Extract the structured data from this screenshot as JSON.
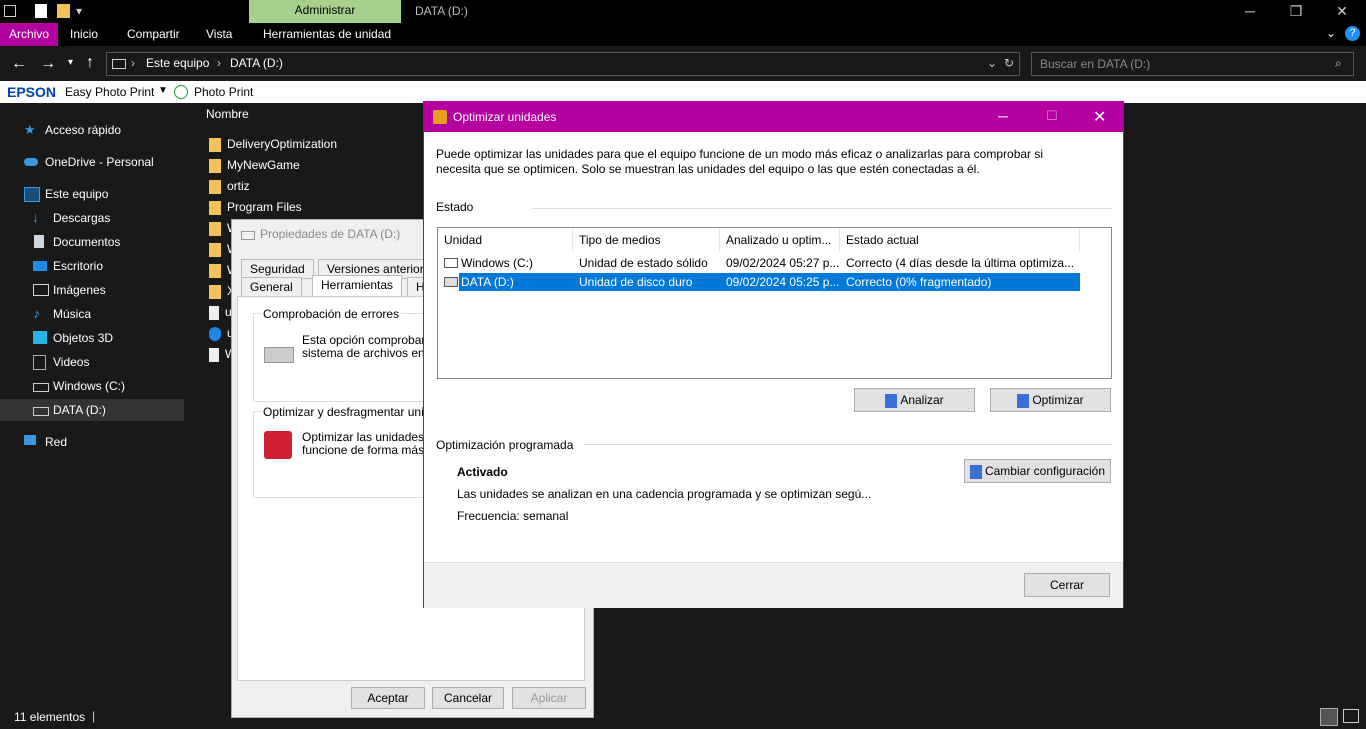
{
  "explorer": {
    "window_title": "DATA (D:)",
    "manage_tab": "Administrar",
    "ribbon_tabs": [
      "Archivo",
      "Inicio",
      "Compartir",
      "Vista",
      "Herramientas de unidad"
    ],
    "breadcrumb": [
      "Este equipo",
      "DATA (D:)"
    ],
    "search_placeholder": "Buscar en DATA (D:)",
    "epson_brand": "EPSON",
    "epson_app": "Easy Photo Print",
    "photo_print": "Photo Print",
    "sidebar": [
      {
        "label": "Acceso rápido",
        "icon": "star-icon"
      },
      {
        "label": "OneDrive - Personal",
        "icon": "cloud-icon"
      },
      {
        "label": "Este equipo",
        "icon": "computer-icon"
      },
      {
        "label": "Descargas",
        "icon": "download-icon"
      },
      {
        "label": "Documentos",
        "icon": "document-icon"
      },
      {
        "label": "Escritorio",
        "icon": "desktop-icon"
      },
      {
        "label": "Imágenes",
        "icon": "image-icon"
      },
      {
        "label": "Música",
        "icon": "music-icon"
      },
      {
        "label": "Objetos 3D",
        "icon": "cube-icon"
      },
      {
        "label": "Videos",
        "icon": "video-icon"
      },
      {
        "label": "Windows (C:)",
        "icon": "drive-icon"
      },
      {
        "label": "DATA (D:)",
        "icon": "drive-icon"
      },
      {
        "label": "Red",
        "icon": "network-icon"
      }
    ],
    "column_name": "Nombre",
    "files": [
      "DeliveryOptimization",
      "MyNewGame",
      "ortiz",
      "Program Files",
      "W",
      "W",
      "W",
      "X",
      "u",
      "u",
      "W"
    ],
    "status": "11 elementos"
  },
  "properties": {
    "title": "Propiedades de DATA (D:)",
    "tabs_row1": [
      "Seguridad",
      "Versiones anteriores"
    ],
    "tabs_row2": [
      "General",
      "Herramientas",
      "H"
    ],
    "error_group": "Comprobación de errores",
    "error_text1": "Esta opción comprobará s",
    "error_text2": "sistema de archivos en la",
    "defrag_group": "Optimizar y desfragmentar unidad",
    "defrag_text1": "Optimizar las unidades de",
    "defrag_text2": "funcione de forma más efic",
    "ok": "Aceptar",
    "cancel": "Cancelar",
    "apply": "Aplicar"
  },
  "optimize": {
    "title": "Optimizar unidades",
    "intro1": "Puede optimizar las unidades para que el equipo funcione de un modo más eficaz o analizarlas para comprobar si",
    "intro2": "necesita que se optimicen. Solo se muestran las unidades del equipo o las que estén conectadas a él.",
    "status_label": "Estado",
    "columns": [
      "Unidad",
      "Tipo de medios",
      "Analizado u optim...",
      "Estado actual"
    ],
    "drives": [
      {
        "unit": "Windows (C:)",
        "media": "Unidad de estado sólido",
        "analyzed": "09/02/2024 05:27 p...",
        "state": "Correcto (4 días desde la última optimiza..."
      },
      {
        "unit": "DATA (D:)",
        "media": "Unidad de disco duro",
        "analyzed": "09/02/2024 05:25 p...",
        "state": "Correcto (0% fragmentado)"
      }
    ],
    "analyze": "Analizar",
    "optimize": "Optimizar",
    "scheduled_label": "Optimización programada",
    "activated": "Activado",
    "schedule_desc": "Las unidades se analizan en una cadencia programada y se optimizan segú...",
    "frequency": "Frecuencia: semanal",
    "change_config": "Cambiar configuración",
    "close": "Cerrar"
  },
  "colors": {
    "accent": "#b4009e",
    "selection": "#0078d7",
    "manage": "#a8d08d"
  }
}
